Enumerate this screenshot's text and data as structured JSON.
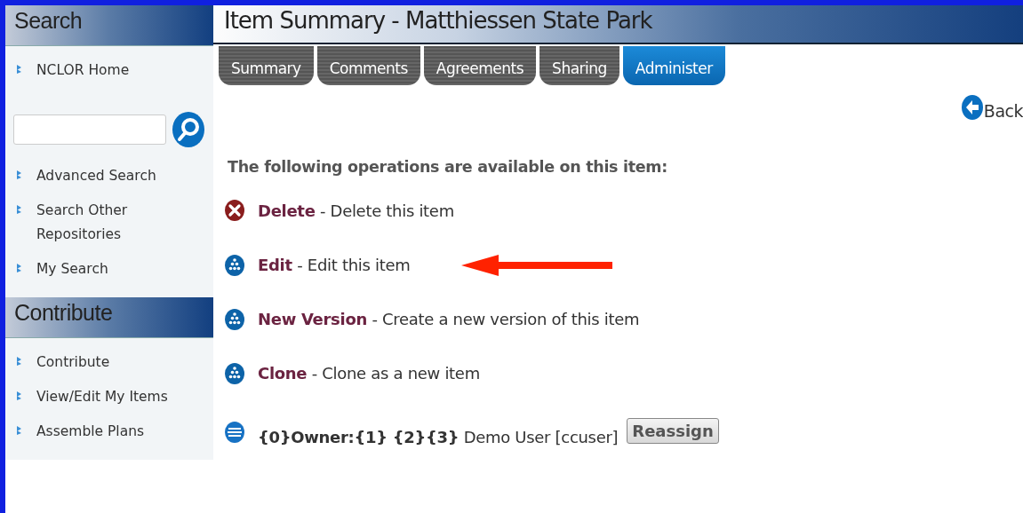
{
  "sidebar": {
    "sections": [
      {
        "title": "Search",
        "items": [
          {
            "kind": "link",
            "label": "NCLOR Home"
          },
          {
            "kind": "search"
          },
          {
            "kind": "link",
            "label": "Advanced Search"
          },
          {
            "kind": "link",
            "label": "Search Other Repositories"
          },
          {
            "kind": "link",
            "label": "My Search"
          }
        ]
      },
      {
        "title": "Contribute",
        "items": [
          {
            "kind": "link",
            "label": "Contribute"
          },
          {
            "kind": "link",
            "label": "View/Edit My Items"
          },
          {
            "kind": "link",
            "label": "Assemble Plans"
          }
        ]
      }
    ]
  },
  "page_title": "Item Summary - Matthiessen State Park",
  "tabs": [
    {
      "label": "Summary",
      "selected": false
    },
    {
      "label": "Comments",
      "selected": false
    },
    {
      "label": "Agreements",
      "selected": false
    },
    {
      "label": "Sharing",
      "selected": false
    },
    {
      "label": "Administer",
      "selected": true
    }
  ],
  "back_link": "Back",
  "heading": "The following operations are available on this item:",
  "operations": [
    {
      "kind": "delete",
      "name": "Delete",
      "description": "- Delete this item"
    },
    {
      "kind": "action",
      "name": "Edit",
      "description": "- Edit this item",
      "pointer": true
    },
    {
      "kind": "action",
      "name": "New Version",
      "description": "- Create a new version of this item"
    },
    {
      "kind": "action",
      "name": "Clone",
      "description": "- Clone as a new item"
    },
    {
      "kind": "owner",
      "name": "{0}Owner:{1} {2}{3}",
      "description": "Demo User [ccuser]",
      "button": "Reassign"
    }
  ]
}
